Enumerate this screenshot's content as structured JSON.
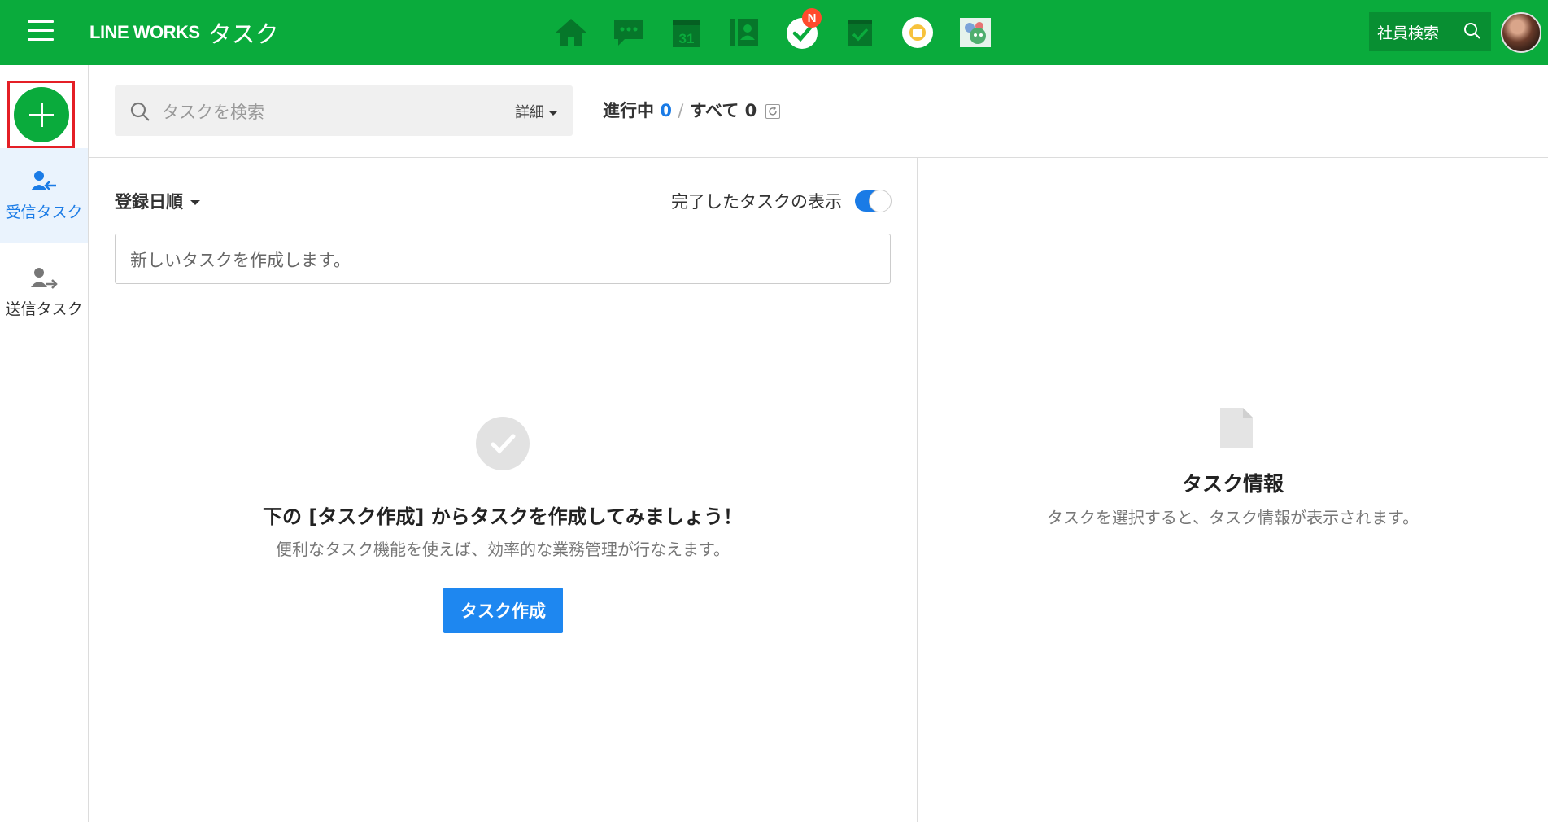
{
  "header": {
    "logo": "LINE WORKS",
    "app_name": "タスク",
    "task_badge": "N",
    "calendar_day": "31",
    "employee_search_label": "社員検索",
    "bg_color": "#0aab3c"
  },
  "nav_icons": [
    "home-icon",
    "chat-icon",
    "calendar-icon",
    "address-book-icon",
    "task-icon",
    "drive-icon",
    "mail-icon",
    "bot-icon"
  ],
  "leftnav": {
    "add_button": "+",
    "items": [
      {
        "label": "受信タスク",
        "icon": "received-task-icon",
        "active": true
      },
      {
        "label": "送信タスク",
        "icon": "sent-task-icon",
        "active": false
      }
    ]
  },
  "search": {
    "placeholder": "タスクを検索",
    "detail_label": "詳細"
  },
  "counts": {
    "in_progress_label": "進行中",
    "in_progress": "0",
    "separator": "/",
    "all_label": "すべて",
    "all": "0"
  },
  "list": {
    "sort_label": "登録日順",
    "show_completed_label": "完了したタスクの表示",
    "show_completed": true,
    "new_task_placeholder": "新しいタスクを作成します。",
    "empty_title": "下の [タスク作成] からタスクを作成してみましょう！",
    "empty_subtitle": "便利なタスク機能を使えば、効率的な業務管理が行なえます。",
    "create_button": "タスク作成"
  },
  "detail": {
    "title": "タスク情報",
    "subtitle": "タスクを選択すると、タスク情報が表示されます。"
  }
}
